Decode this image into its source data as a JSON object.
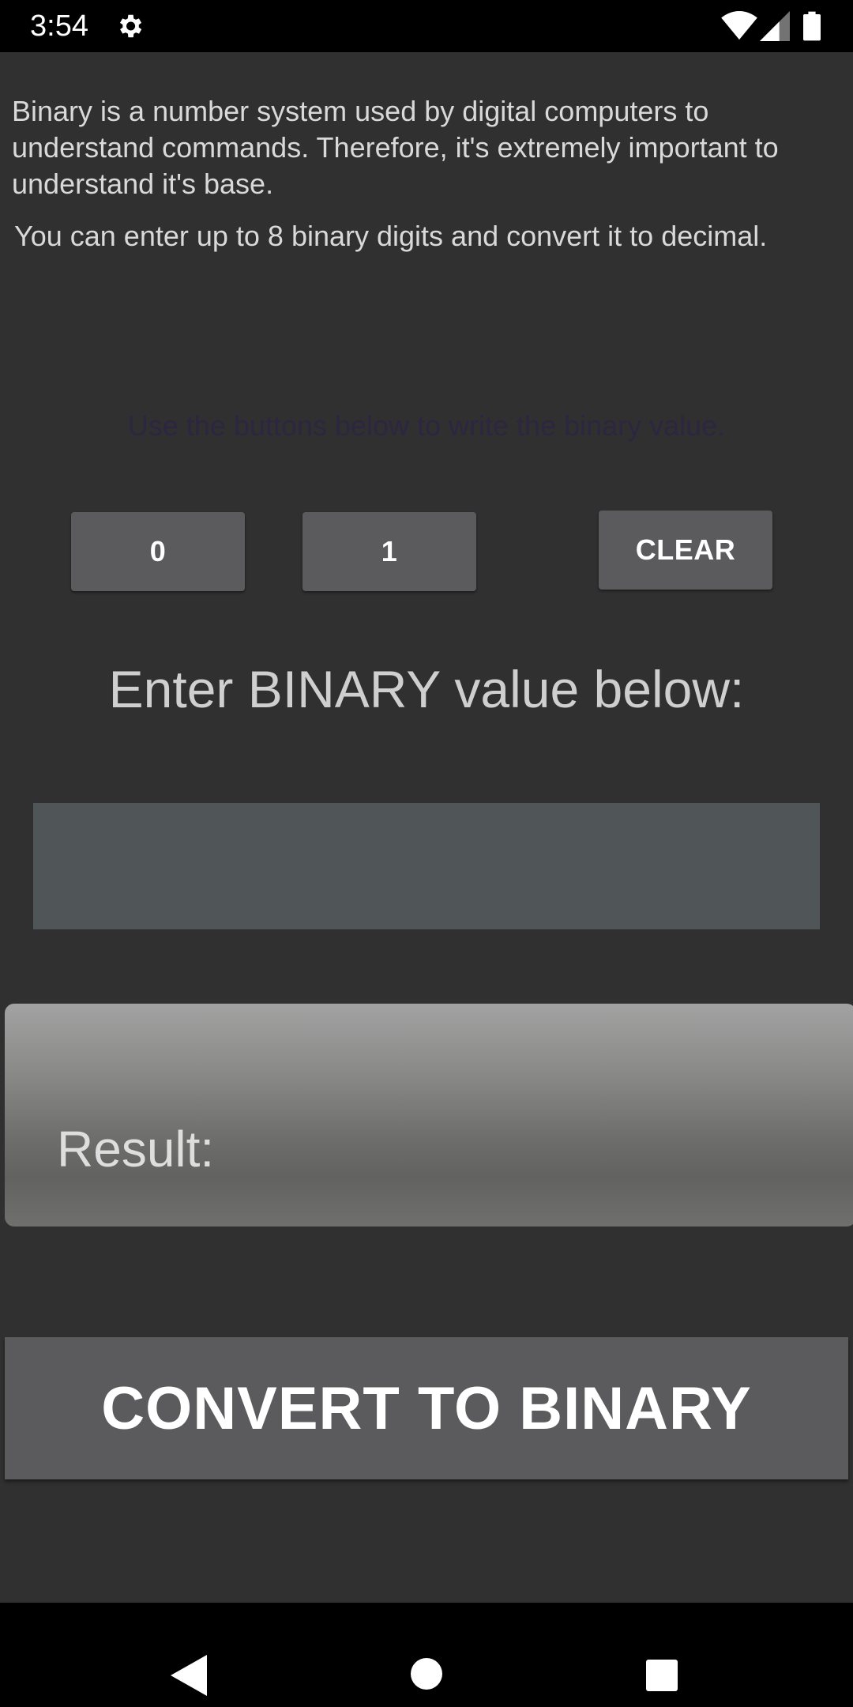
{
  "status_bar": {
    "time": "3:54",
    "icons": [
      "gear-icon",
      "wifi-icon",
      "signal-icon",
      "battery-icon"
    ]
  },
  "content": {
    "intro": "Binary is a number system used by digital computers to understand commands. Therefore, it's extremely important to understand it's base.",
    "limit": "You can enter up to 8 binary digits and convert it to decimal.",
    "hint": "Use the buttons below to write the binary value.",
    "buttons": {
      "zero": "0",
      "one": "1",
      "clear": "CLEAR"
    },
    "enter_label": "Enter BINARY value below:",
    "input_value": "",
    "result_label": "Result:",
    "convert_button": "CONVERT TO BINARY"
  },
  "nav_bar": {
    "icons": [
      "back-icon",
      "home-icon",
      "recents-icon"
    ]
  },
  "colors": {
    "background": "#303030",
    "button": "#5b5b5d",
    "input": "#505557",
    "hint_text": "#2d2640"
  }
}
